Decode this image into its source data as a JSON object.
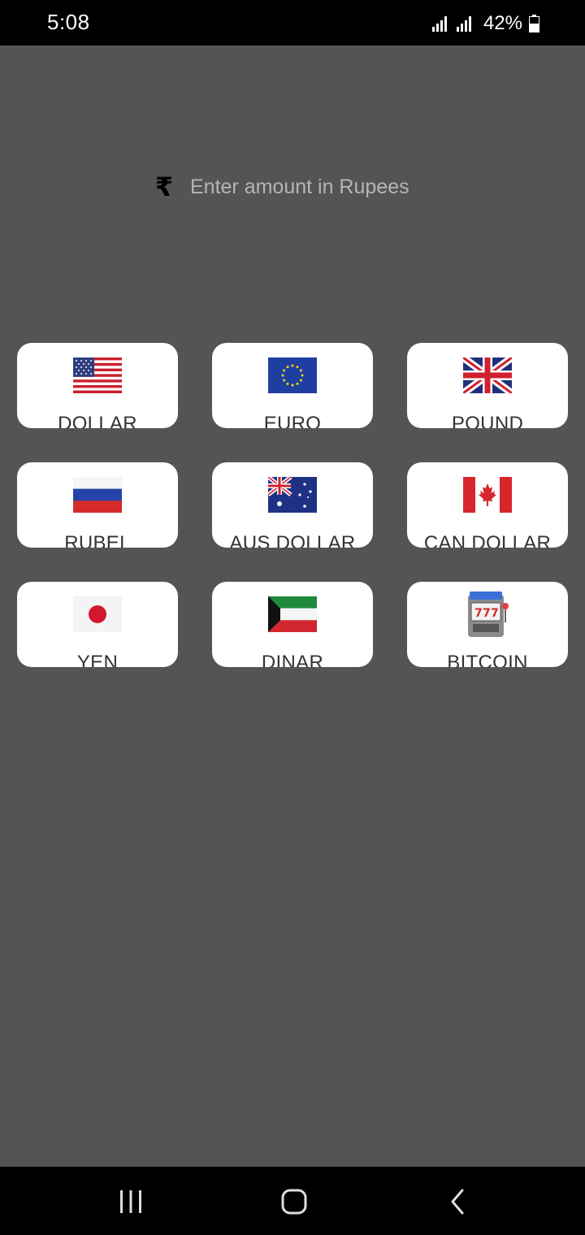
{
  "status": {
    "time": "5:08",
    "battery": "42%"
  },
  "input": {
    "icon": "rupee-icon",
    "placeholder": "Enter amount in Rupees",
    "value": ""
  },
  "currencies": [
    {
      "label": "DOLLAR",
      "icon": "us-flag-icon"
    },
    {
      "label": "EURO",
      "icon": "eu-flag-icon"
    },
    {
      "label": "POUND",
      "icon": "uk-flag-icon"
    },
    {
      "label": "RUBEL",
      "icon": "russia-flag-icon"
    },
    {
      "label": "AUS DOLLAR",
      "icon": "australia-flag-icon"
    },
    {
      "label": "CAN DOLLAR",
      "icon": "canada-flag-icon"
    },
    {
      "label": "YEN",
      "icon": "japan-flag-icon"
    },
    {
      "label": "DINAR",
      "icon": "kuwait-flag-icon"
    },
    {
      "label": "BITCOIN",
      "icon": "slot-machine-icon"
    }
  ],
  "colors": {
    "background": "#545454",
    "card": "#ffffff",
    "text": "#333333"
  }
}
